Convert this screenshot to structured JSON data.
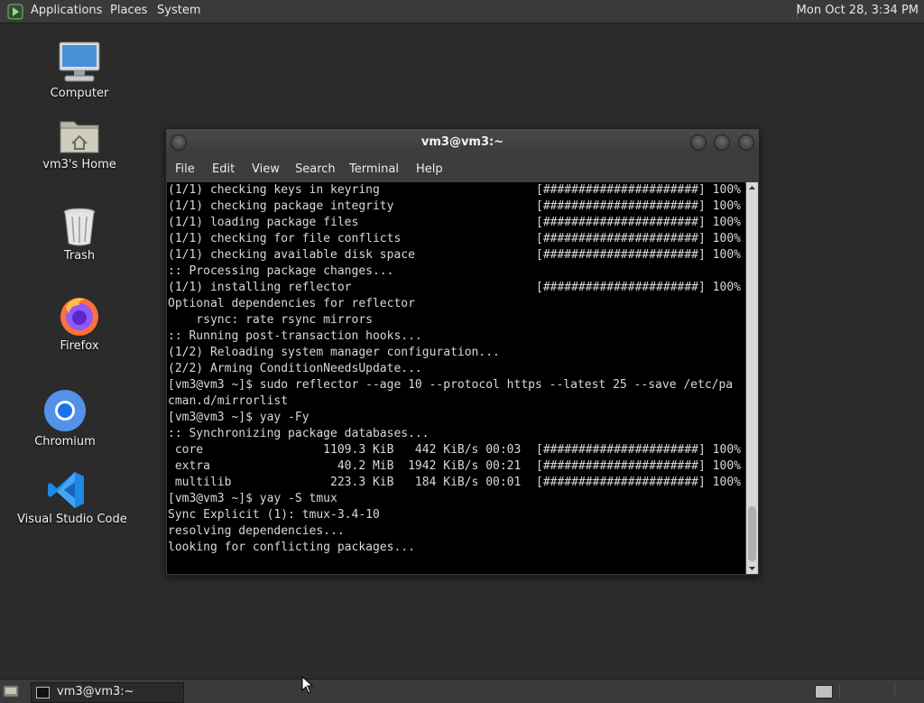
{
  "top_panel": {
    "menus": [
      "Applications",
      "Places",
      "System"
    ],
    "clock": "Mon Oct 28,  3:34 PM"
  },
  "desktop_icons": [
    {
      "label": "Computer",
      "icon": "computer-icon"
    },
    {
      "label": "vm3's Home",
      "icon": "home-folder-icon"
    },
    {
      "label": "Trash",
      "icon": "trash-icon"
    },
    {
      "label": "Firefox",
      "icon": "firefox-icon"
    },
    {
      "label": "Chromium",
      "icon": "chromium-icon"
    },
    {
      "label": "Visual Studio Code",
      "icon": "vscode-icon"
    }
  ],
  "terminal": {
    "title": "vm3@vm3:~",
    "menu": [
      "File",
      "Edit",
      "View",
      "Search",
      "Terminal",
      "Help"
    ],
    "lines": [
      {
        "left": "(1/1) checking keys in keyring",
        "right": "[######################] 100%"
      },
      {
        "left": "(1/1) checking package integrity",
        "right": "[######################] 100%"
      },
      {
        "left": "(1/1) loading package files",
        "right": "[######################] 100%"
      },
      {
        "left": "(1/1) checking for file conflicts",
        "right": "[######################] 100%"
      },
      {
        "left": "(1/1) checking available disk space",
        "right": "[######################] 100%"
      },
      {
        "left": ":: Processing package changes...",
        "right": ""
      },
      {
        "left": "(1/1) installing reflector",
        "right": "[######################] 100%"
      },
      {
        "left": "Optional dependencies for reflector",
        "right": ""
      },
      {
        "left": "    rsync: rate rsync mirrors",
        "right": ""
      },
      {
        "left": ":: Running post-transaction hooks...",
        "right": ""
      },
      {
        "left": "(1/2) Reloading system manager configuration...",
        "right": ""
      },
      {
        "left": "(2/2) Arming ConditionNeedsUpdate...",
        "right": ""
      },
      {
        "left": "[vm3@vm3 ~]$ sudo reflector --age 10 --protocol https --latest 25 --save /etc/pa",
        "right": ""
      },
      {
        "left": "cman.d/mirrorlist",
        "right": ""
      },
      {
        "left": "[vm3@vm3 ~]$ yay -Fy",
        "right": ""
      },
      {
        "left": ":: Synchronizing package databases...",
        "right": ""
      },
      {
        "left": " core                 1109.3 KiB   442 KiB/s 00:03",
        "right": "[######################] 100%"
      },
      {
        "left": " extra                  40.2 MiB  1942 KiB/s 00:21",
        "right": "[######################] 100%"
      },
      {
        "left": " multilib              223.3 KiB   184 KiB/s 00:01",
        "right": "[######################] 100%"
      },
      {
        "left": "[vm3@vm3 ~]$ yay -S tmux",
        "right": ""
      },
      {
        "left": "Sync Explicit (1): tmux-3.4-10",
        "right": ""
      },
      {
        "left": "resolving dependencies...",
        "right": ""
      },
      {
        "left": "looking for conflicting packages...",
        "right": ""
      }
    ]
  },
  "taskbar": {
    "window_button": "vm3@vm3:~"
  },
  "colors": {
    "desktop_bg": "#2b2b2b",
    "panel_bg": "#3a3a3a",
    "terminal_bg": "#000000",
    "terminal_fg": "#d8d8d8"
  }
}
